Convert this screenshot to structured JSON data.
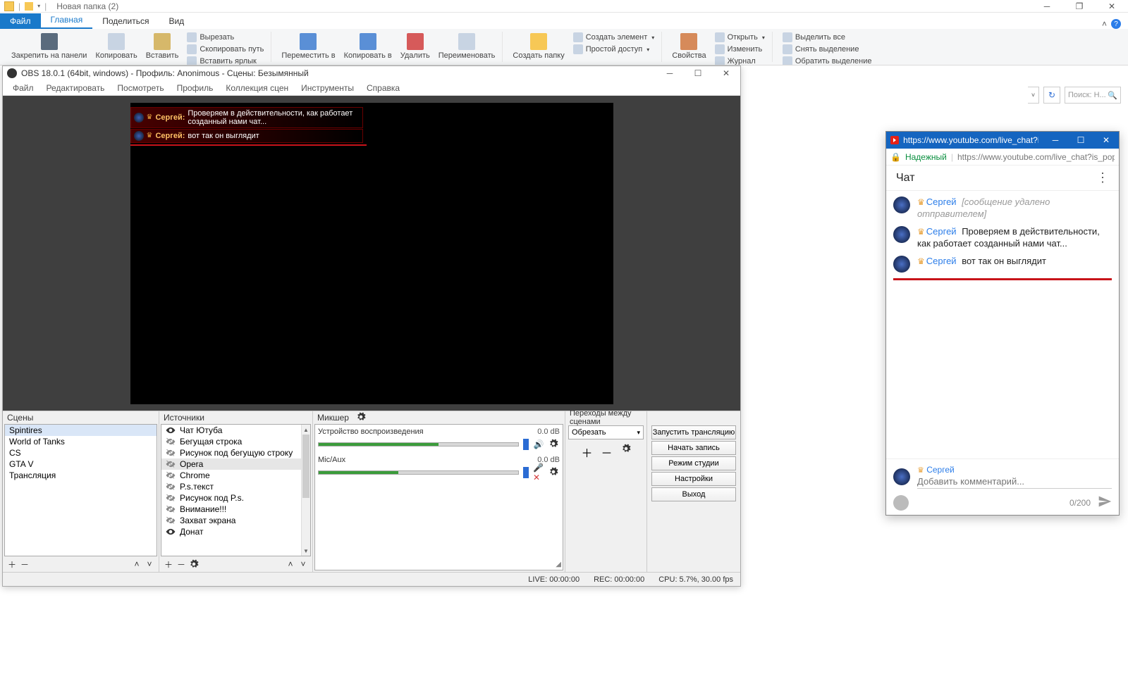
{
  "explorer": {
    "title": "Новая папка (2)",
    "tabs": {
      "file": "Файл",
      "home": "Главная",
      "share": "Поделиться",
      "view": "Вид"
    },
    "ribbon": {
      "pin": "Закрепить на панели",
      "copy": "Копировать",
      "paste": "Вставить",
      "cut": "Вырезать",
      "copypath": "Скопировать путь",
      "pasteshortcut": "Вставить ярлык",
      "moveto": "Переместить в",
      "copyto": "Копировать в",
      "delete": "Удалить",
      "rename": "Переименовать",
      "newfolder": "Создать папку",
      "newitem": "Создать элемент",
      "easyaccess": "Простой доступ",
      "properties": "Свойства",
      "open": "Открыть",
      "edit": "Изменить",
      "history": "Журнал",
      "selectall": "Выделить все",
      "selectnone": "Снять выделение",
      "invertsel": "Обратить выделение"
    },
    "search_placeholder": "Поиск: Н..."
  },
  "obs": {
    "title": "OBS 18.0.1 (64bit, windows) - Профиль: Anonimous - Сцены: Безымянный",
    "menu": [
      "Файл",
      "Редактировать",
      "Посмотреть",
      "Профиль",
      "Коллекция сцен",
      "Инструменты",
      "Справка"
    ],
    "overlay_messages": [
      {
        "name": "Сергей:",
        "text": "Проверяем в действительности, как работает созданный нами чат..."
      },
      {
        "name": "Сергей:",
        "text": "вот так он выглядит"
      }
    ],
    "panels": {
      "scenes_title": "Сцены",
      "scenes": [
        "Spintires",
        "World of Tanks",
        "CS",
        "GTA V",
        "Трансляция"
      ],
      "sources_title": "Источники",
      "sources": [
        {
          "label": "Чат Ютуба",
          "visible": true
        },
        {
          "label": "Бегущая строка",
          "visible": false
        },
        {
          "label": "Рисунок под бегущую строку",
          "visible": false
        },
        {
          "label": "Opera",
          "visible": false,
          "selected": true
        },
        {
          "label": "Chrome",
          "visible": false
        },
        {
          "label": "P.s.текст",
          "visible": false
        },
        {
          "label": "Рисунок под P.s.",
          "visible": false
        },
        {
          "label": "Внимание!!!",
          "visible": false
        },
        {
          "label": "Захват экрана",
          "visible": false
        },
        {
          "label": "Донат",
          "visible": true
        }
      ],
      "mixer_title": "Микшер",
      "mixer": [
        {
          "name": "Устройство воспроизведения",
          "db": "0.0 dB",
          "muted": false
        },
        {
          "name": "Mic/Aux",
          "db": "0.0 dB",
          "muted": true
        }
      ],
      "transitions_title": "Переходы между сценами",
      "transition_sel": "Обрезать",
      "controls": {
        "start_stream": "Запустить трансляцию",
        "start_record": "Начать запись",
        "studio_mode": "Режим студии",
        "settings": "Настройки",
        "exit": "Выход"
      }
    },
    "status": {
      "live": "LIVE: 00:00:00",
      "rec": "REC: 00:00:00",
      "cpu": "CPU: 5.7%, 30.00 fps"
    }
  },
  "youtube": {
    "title_short": "https://www.youtube.com/live_chat?is_p...",
    "safe_label": "Надежный",
    "url": "https://www.youtube.com/live_chat?is_popou",
    "chat_title": "Чат",
    "messages": [
      {
        "name": "Сергей",
        "deleted": true,
        "deleted_text": "[сообщение удалено отправителем]"
      },
      {
        "name": "Сергей",
        "text": "Проверяем в действительности, как работает созданный нами чат..."
      },
      {
        "name": "Сергей",
        "text": "вот так он выглядит"
      }
    ],
    "input_user": "Сергей",
    "input_placeholder": "Добавить комментарий...",
    "counter": "0/200"
  }
}
